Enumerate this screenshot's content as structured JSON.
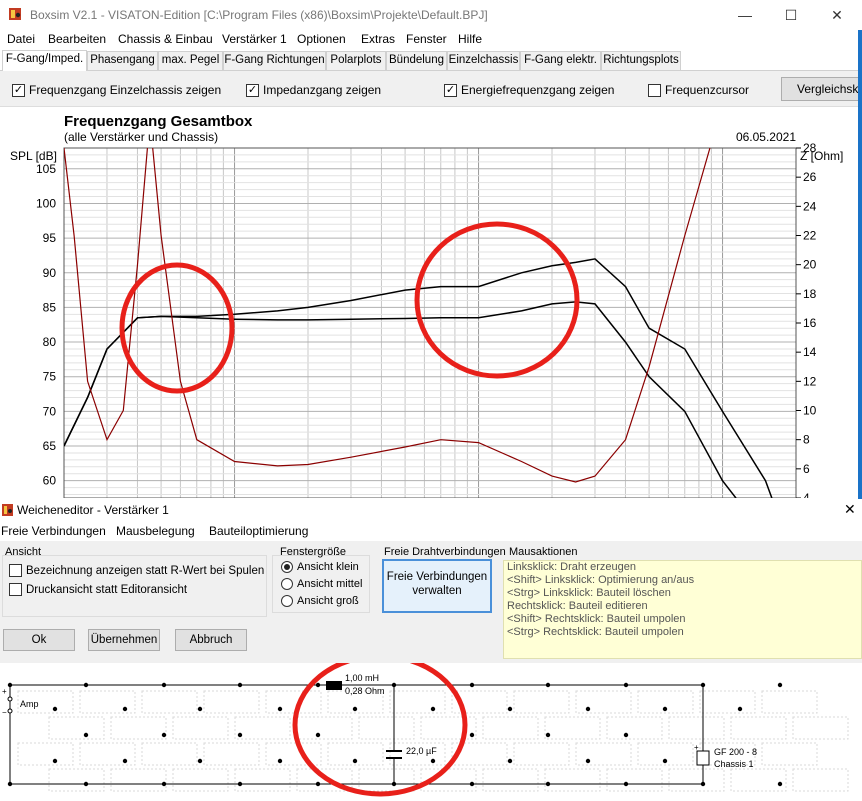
{
  "window": {
    "title": "Boxsim V2.1 - VISATON-Edition [C:\\Program Files (x86)\\Boxsim\\Projekte\\Default.BPJ]",
    "minimize": "—",
    "maximize": "☐",
    "close": "✕"
  },
  "menu": [
    "Datei",
    "Bearbeiten",
    "Chassis & Einbau",
    "Verstärker 1",
    "Optionen",
    "Extras",
    "Fenster",
    "Hilfe"
  ],
  "tabs": [
    "F-Gang/Imped.",
    "Phasengang",
    "max. Pegel",
    "F-Gang Richtungen",
    "Polarplots",
    "Bündelung",
    "Einzelchassis",
    "F-Gang elektr.",
    "Richtungsplots"
  ],
  "active_tab": 0,
  "checks": [
    {
      "label": "Frequenzgang Einzelchassis zeigen",
      "checked": true
    },
    {
      "label": "Impedanzgang zeigen",
      "checked": true
    },
    {
      "label": "Energiefrequenzgang zeigen",
      "checked": true
    },
    {
      "label": "Frequenzcursor",
      "checked": false
    }
  ],
  "compare_button": "Vergleichskurve",
  "chart_data": {
    "type": "line",
    "title": "Frequenzgang Gesamtbox",
    "subtitle": "(alle Verstärker und Chassis)",
    "date": "06.05.2021",
    "ylabel": "SPL [dB]",
    "y2label": "Z [Ohm]",
    "yticks": [
      "105",
      "100",
      "95",
      "90",
      "85",
      "80",
      "75",
      "70",
      "65",
      "60"
    ],
    "y2ticks": [
      "28",
      "26",
      "24",
      "22",
      "20",
      "18",
      "16",
      "14",
      "12",
      "10",
      "8",
      "6",
      "4"
    ],
    "ylim": [
      57.5,
      108
    ],
    "y2lim": [
      4,
      28
    ],
    "series": [
      {
        "name": "SPL",
        "color": "#000000",
        "x": [
          20,
          25,
          30,
          40,
          50,
          70,
          100,
          150,
          200,
          300,
          500,
          700,
          1000,
          1500,
          2000,
          2500,
          3000,
          4000,
          5000,
          7000,
          10000,
          15000,
          20000
        ],
        "values": [
          65,
          72,
          79,
          83.5,
          83.7,
          83.7,
          84,
          84.5,
          85,
          86,
          87.5,
          88,
          88,
          90,
          91,
          91.5,
          92,
          88,
          82,
          79,
          70,
          60,
          48
        ]
      },
      {
        "name": "SPL 2",
        "color": "#000000",
        "x": [
          20,
          25,
          30,
          40,
          50,
          70,
          100,
          150,
          200,
          300,
          500,
          700,
          1000,
          1500,
          2000,
          2500,
          3000,
          4000,
          5000,
          7000,
          10000,
          15000,
          20000
        ],
        "values": [
          65,
          72,
          79,
          83.5,
          83.7,
          83.5,
          83.3,
          83.2,
          83.2,
          83.3,
          83.4,
          83.5,
          83.5,
          84.5,
          85.5,
          85.8,
          85.5,
          80,
          75,
          70,
          60,
          52,
          45
        ]
      },
      {
        "name": "Impedanz",
        "color": "#8b0000",
        "x": [
          20,
          22,
          25,
          30,
          35,
          40,
          45,
          50,
          60,
          70,
          100,
          150,
          200,
          300,
          500,
          700,
          1000,
          1500,
          2000,
          2500,
          3000,
          4000,
          5000,
          7000,
          10000,
          15000,
          20000
        ],
        "values": [
          28,
          22,
          12,
          8,
          10,
          20,
          30,
          22,
          12,
          8,
          6.5,
          6.2,
          6.3,
          6.8,
          7.5,
          8,
          7.8,
          6.5,
          5.5,
          5.1,
          5.5,
          8,
          13,
          22,
          31,
          31,
          31
        ]
      }
    ]
  },
  "dialog": {
    "title": "Weicheneditor - Verstärker 1",
    "close": "✕",
    "menu": [
      "Freie Verbindungen",
      "Mausbelegung",
      "Bauteiloptimierung"
    ],
    "ansicht_label": "Ansicht",
    "ansicht_checks": [
      "Bezeichnung anzeigen statt R-Wert bei Spulen",
      "Druckansicht statt Editoransicht"
    ],
    "fenster_label": "Fenstergröße",
    "fenster_options": [
      {
        "label": "Ansicht klein",
        "selected": true
      },
      {
        "label": "Ansicht mittel",
        "selected": false
      },
      {
        "label": "Ansicht groß",
        "selected": false
      }
    ],
    "draht_label": "Freie Drahtverbindungen",
    "draht_button": [
      "Freie Verbindungen",
      "verwalten"
    ],
    "maus_label": "Mausaktionen",
    "maus_lines": [
      "Linksklick: Draht erzeugen",
      "<Shift> Linksklick: Optimierung an/aus",
      "<Strg> Linksklick: Bauteil löschen",
      "Rechtsklick: Bauteil editieren",
      "<Shift> Rechtsklick: Bauteil umpolen",
      "<Strg> Rechtsklick: Bauteil umpolen"
    ],
    "buttons": [
      "Ok",
      "Übernehmen",
      "Abbruch"
    ]
  },
  "schematic": {
    "amp_label": "Amp",
    "coil_value": "1,00 mH",
    "coil_resistance": "0,28 Ohm",
    "cap_value": "22,0 µF",
    "driver_name": "GF 200 - 8",
    "driver_label": "Chassis 1"
  },
  "annotation_color": "#e8201a"
}
